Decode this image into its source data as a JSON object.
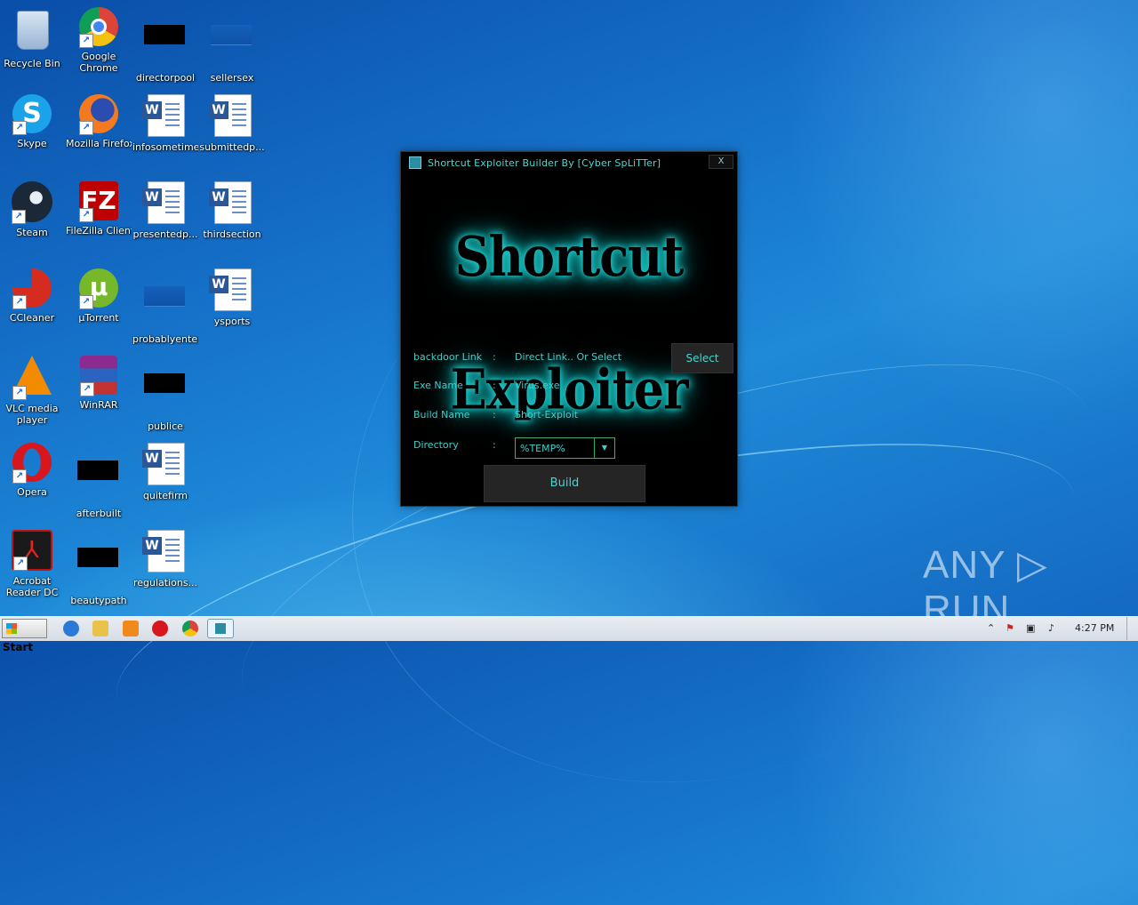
{
  "desktop": {
    "icons": [
      {
        "label": "Recycle Bin",
        "icon": "recycle-bin-icon"
      },
      {
        "label": "Google Chrome",
        "icon": "chrome-icon"
      },
      {
        "label": "directorpool",
        "icon": "black-file-icon"
      },
      {
        "label": "sellersex",
        "icon": "blue-file-icon"
      },
      {
        "label": "Skype",
        "icon": "skype-icon"
      },
      {
        "label": "Mozilla Firefox",
        "icon": "firefox-icon"
      },
      {
        "label": "infosometimes",
        "icon": "word-document-icon"
      },
      {
        "label": "submittedp...",
        "icon": "word-document-icon"
      },
      {
        "label": "Steam",
        "icon": "steam-icon"
      },
      {
        "label": "FileZilla Client",
        "icon": "filezilla-icon"
      },
      {
        "label": "presentedp...",
        "icon": "word-document-icon"
      },
      {
        "label": "thirdsection",
        "icon": "word-document-icon"
      },
      {
        "label": "CCleaner",
        "icon": "ccleaner-icon"
      },
      {
        "label": "µTorrent",
        "icon": "utorrent-icon"
      },
      {
        "label": "probablyenter",
        "icon": "blue-file-icon"
      },
      {
        "label": "ysports",
        "icon": "word-document-icon"
      },
      {
        "label": "VLC media player",
        "icon": "vlc-icon"
      },
      {
        "label": "WinRAR",
        "icon": "winrar-icon"
      },
      {
        "label": "publice",
        "icon": "black-file-icon"
      },
      {
        "label": "Opera",
        "icon": "opera-icon"
      },
      {
        "label": "afterbuilt",
        "icon": "black-file-icon"
      },
      {
        "label": "quitefirm",
        "icon": "word-document-icon"
      },
      {
        "label": "Acrobat Reader DC",
        "icon": "acrobat-icon"
      },
      {
        "label": "beautypath",
        "icon": "black-file-icon"
      },
      {
        "label": "regulations...",
        "icon": "word-document-icon"
      }
    ]
  },
  "window": {
    "title": "Shortcut Exploiter Builder  By [Cyber SpLiTTer]",
    "close_label": "X",
    "banner": "Shortcut Exploiter",
    "fields": {
      "backdoor_label": "backdoor Link",
      "backdoor_value": "Direct Link.. Or Select",
      "exe_label": "Exe Name",
      "exe_value": "Virus.exe",
      "build_name_label": "Build Name",
      "build_name_value": "Short-Exploit",
      "directory_label": "Directory",
      "directory_value": "%TEMP%",
      "separator": ":"
    },
    "select_label": "Select",
    "build_label": "Build",
    "accent_color": "#3fd0cc"
  },
  "taskbar": {
    "start_label": "Start",
    "pinned": [
      "ie-icon",
      "explorer-icon",
      "media-player-icon",
      "opera-icon",
      "chrome-icon",
      "shortcut-exploiter-icon"
    ],
    "clock": "4:27 PM"
  },
  "watermark": "ANY ▷ RUN"
}
